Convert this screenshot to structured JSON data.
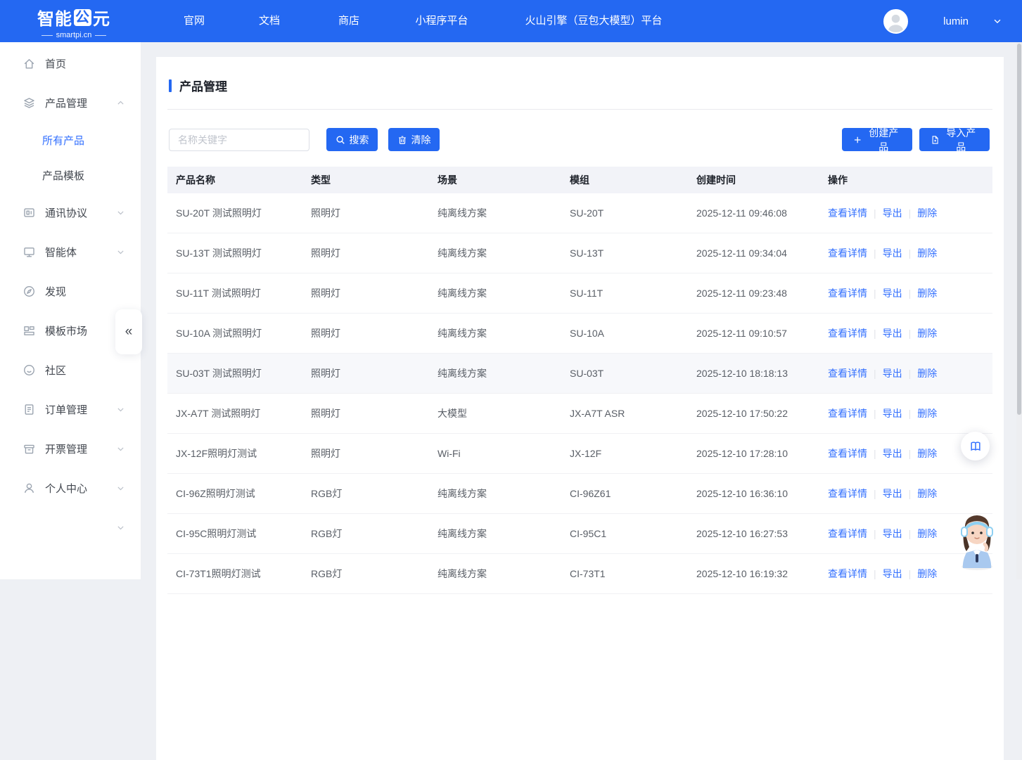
{
  "navbar": {
    "logo": {
      "text_left": "智能",
      "boxed_char": "公",
      "text_right": "元",
      "subtitle": "smartpi.cn"
    },
    "items": [
      {
        "label": "官网"
      },
      {
        "label": "文档"
      },
      {
        "label": "商店"
      },
      {
        "label": "小程序平台"
      },
      {
        "label": "火山引擎（豆包大模型）平台"
      }
    ],
    "user": {
      "name": "lumin"
    }
  },
  "sidebar": {
    "collapse_glyph": "«",
    "items": [
      {
        "id": "home",
        "icon": "home-icon",
        "label": "首页",
        "chevron": null
      },
      {
        "id": "product-management",
        "icon": "layers-icon",
        "label": "产品管理",
        "chevron": "up",
        "children": [
          {
            "label": "所有产品",
            "active": true
          },
          {
            "label": "产品模板",
            "active": false
          }
        ]
      },
      {
        "id": "protocol",
        "icon": "protocol-icon",
        "label": "通讯协议",
        "chevron": "down"
      },
      {
        "id": "agent",
        "icon": "monitor-icon",
        "label": "智能体",
        "chevron": "down"
      },
      {
        "id": "discover",
        "icon": "compass-icon",
        "label": "发现",
        "chevron": null
      },
      {
        "id": "template-market",
        "icon": "layout-icon",
        "label": "模板市场",
        "chevron": null
      },
      {
        "id": "community",
        "icon": "smile-icon",
        "label": "社区",
        "chevron": null
      },
      {
        "id": "orders",
        "icon": "document-icon",
        "label": "订单管理",
        "chevron": "down"
      },
      {
        "id": "invoicing",
        "icon": "archive-icon",
        "label": "开票管理",
        "chevron": "down"
      },
      {
        "id": "profile",
        "icon": "user-icon",
        "label": "个人中心",
        "chevron": "down"
      },
      {
        "id": "extra",
        "icon": null,
        "label": "",
        "chevron": "down"
      }
    ]
  },
  "page": {
    "title": "产品管理",
    "search": {
      "placeholder": "名称关键字",
      "value": ""
    },
    "buttons": {
      "search": "搜索",
      "clear": "清除",
      "create": "创建产品",
      "import": "导入产品"
    }
  },
  "table": {
    "columns": [
      "产品名称",
      "类型",
      "场景",
      "模组",
      "创建时间",
      "操作"
    ],
    "actions": [
      "查看详情",
      "导出",
      "删除"
    ],
    "rows": [
      {
        "name": "SU-20T 测试照明灯",
        "type": "照明灯",
        "scene": "纯离线方案",
        "module": "SU-20T",
        "created": "2025-12-11 09:46:08",
        "highlighted": false
      },
      {
        "name": "SU-13T 测试照明灯",
        "type": "照明灯",
        "scene": "纯离线方案",
        "module": "SU-13T",
        "created": "2025-12-11 09:34:04",
        "highlighted": false
      },
      {
        "name": "SU-11T 测试照明灯",
        "type": "照明灯",
        "scene": "纯离线方案",
        "module": "SU-11T",
        "created": "2025-12-11 09:23:48",
        "highlighted": false
      },
      {
        "name": "SU-10A 测试照明灯",
        "type": "照明灯",
        "scene": "纯离线方案",
        "module": "SU-10A",
        "created": "2025-12-11 09:10:57",
        "highlighted": false
      },
      {
        "name": "SU-03T 测试照明灯",
        "type": "照明灯",
        "scene": "纯离线方案",
        "module": "SU-03T",
        "created": "2025-12-10 18:18:13",
        "highlighted": true
      },
      {
        "name": "JX-A7T 测试照明灯",
        "type": "照明灯",
        "scene": "大模型",
        "module": "JX-A7T ASR",
        "created": "2025-12-10 17:50:22",
        "highlighted": false
      },
      {
        "name": "JX-12F照明灯测试",
        "type": "照明灯",
        "scene": "Wi-Fi",
        "module": "JX-12F",
        "created": "2025-12-10 17:28:10",
        "highlighted": false
      },
      {
        "name": "CI-96Z照明灯测试",
        "type": "RGB灯",
        "scene": "纯离线方案",
        "module": "CI-96Z61",
        "created": "2025-12-10 16:36:10",
        "highlighted": false
      },
      {
        "name": "CI-95C照明灯测试",
        "type": "RGB灯",
        "scene": "纯离线方案",
        "module": "CI-95C1",
        "created": "2025-12-10 16:27:53",
        "highlighted": false
      },
      {
        "name": "CI-73T1照明灯测试",
        "type": "RGB灯",
        "scene": "纯离线方案",
        "module": "CI-73T1",
        "created": "2025-12-10 16:19:32",
        "highlighted": false
      }
    ]
  },
  "floating": {
    "doc_button_icon": "book-icon",
    "assistant_icon": "customer-service-mascot"
  },
  "colors": {
    "primary": "#2468F2",
    "link": "#3370FF",
    "page_bg": "#EEF0F4",
    "table_header_bg": "#F2F3F8",
    "row_highlight": "#F7F8FB"
  }
}
